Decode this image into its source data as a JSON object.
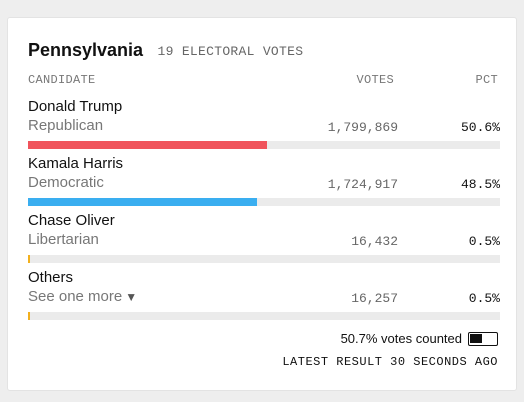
{
  "state": "Pennsylvania",
  "electoral_votes": "19 ELECTORAL VOTES",
  "columns": {
    "candidate": "CANDIDATE",
    "votes": "VOTES",
    "pct": "PCT"
  },
  "candidates": [
    {
      "name": "Donald Trump",
      "party": "Republican",
      "votes": "1,799,869",
      "pct": "50.6%",
      "share": 0.506,
      "color": "#f0545c"
    },
    {
      "name": "Kamala Harris",
      "party": "Democratic",
      "votes": "1,724,917",
      "pct": "48.5%",
      "share": 0.485,
      "color": "#3aaef0"
    },
    {
      "name": "Chase Oliver",
      "party": "Libertarian",
      "votes": "16,432",
      "pct": "0.5%",
      "share": 0.005,
      "color": "#f2b01e"
    },
    {
      "name": "Others",
      "party": "See one more",
      "votes": "16,257",
      "pct": "0.5%",
      "share": 0.005,
      "color": "#f2b01e"
    }
  ],
  "others_toggle_icon": "triangle-down-icon",
  "votes_counted": "50.7% votes counted",
  "latest_result": "LATEST RESULT 30 SECONDS AGO"
}
